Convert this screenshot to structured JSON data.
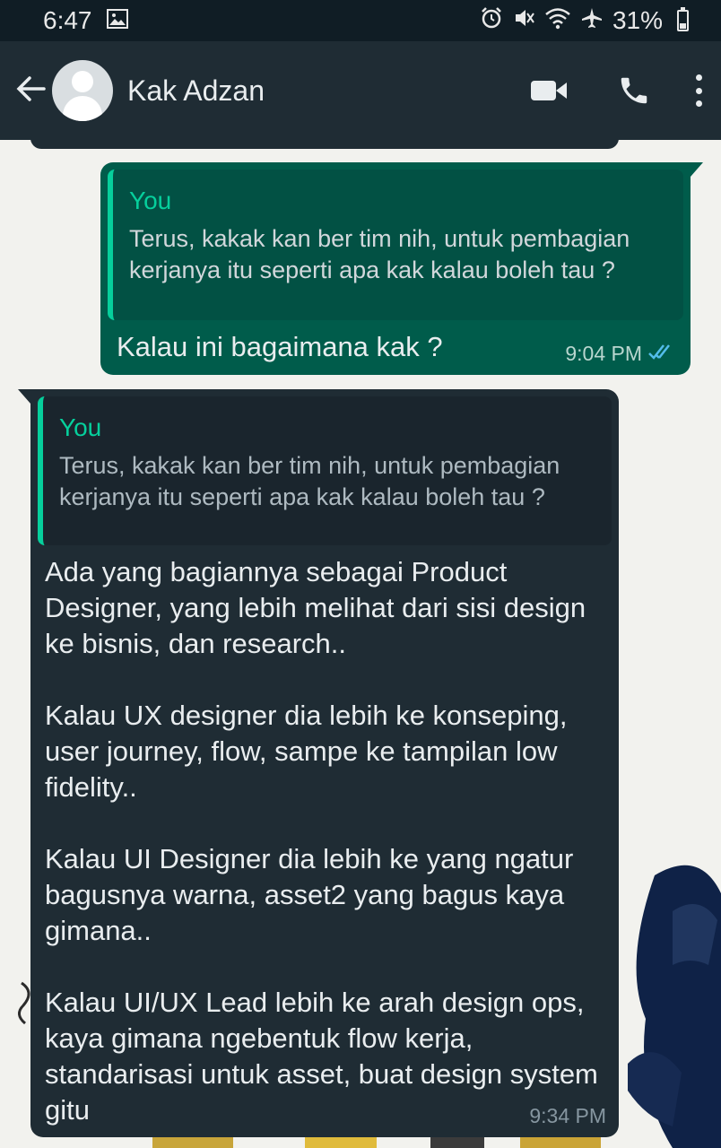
{
  "status_bar": {
    "time": "6:47",
    "battery": "31%",
    "icons": [
      "gallery-icon",
      "alarm-icon",
      "mute-icon",
      "wifi-icon",
      "airplane-icon",
      "battery-icon"
    ]
  },
  "header": {
    "back_icon": "arrow-left-icon",
    "contact_name": "Kak Adzan",
    "actions": [
      "video-call-icon",
      "phone-icon",
      "more-vert-icon"
    ]
  },
  "messages": [
    {
      "direction": "outgoing",
      "quote": {
        "author": "You",
        "text": "Terus, kakak kan ber tim nih, untuk pembagian kerjanya itu seperti apa kak kalau boleh tau ?"
      },
      "text": "Kalau ini bagaimana kak ?",
      "time": "9:04 PM",
      "status": "read"
    },
    {
      "direction": "incoming",
      "quote": {
        "author": "You",
        "text": "Terus, kakak kan ber tim nih, untuk pembagian kerjanya itu seperti apa kak kalau boleh tau ?"
      },
      "text": "Ada yang bagiannya sebagai Product Designer, yang lebih melihat dari sisi design ke bisnis, dan research..\n\nKalau UX designer dia lebih ke konseping, user journey, flow, sampe ke tampilan low fidelity..\n\nKalau UI Designer dia lebih ke yang ngatur bagusnya warna, asset2 yang bagus kaya gimana..\n\nKalau UI/UX Lead lebih ke arah design ops, kaya gimana ngebentuk flow kerja, standarisasi untuk asset, buat design system gitu",
      "time": "9:34 PM"
    }
  ],
  "colors": {
    "status_bar": "#101d25",
    "app_bar": "#1f2c34",
    "outgoing_bubble": "#005c4b",
    "incoming_bubble": "#1f2c34",
    "quote_accent": "#06cf9c",
    "read_ticks": "#53bdeb"
  }
}
